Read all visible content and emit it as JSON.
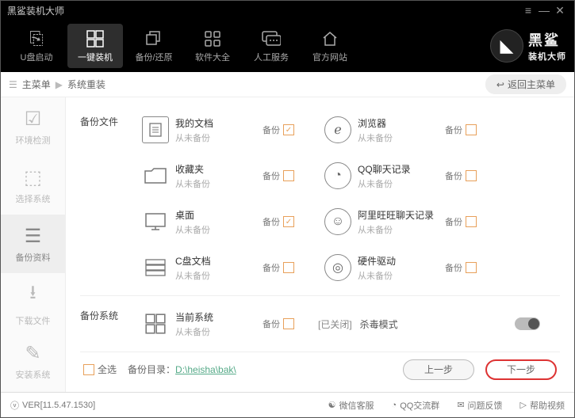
{
  "window_title": "黑鲨装机大师",
  "brand": {
    "t1": "黑鲨",
    "t2": "装机大师"
  },
  "topnav": [
    {
      "label": "U盘启动"
    },
    {
      "label": "一键装机"
    },
    {
      "label": "备份/还原"
    },
    {
      "label": "软件大全"
    },
    {
      "label": "人工服务"
    },
    {
      "label": "官方网站"
    }
  ],
  "crumb": {
    "root": "主菜单",
    "current": "系统重装",
    "back": "返回主菜单"
  },
  "sidebar": [
    {
      "label": "环境检测"
    },
    {
      "label": "选择系统"
    },
    {
      "label": "备份资料"
    },
    {
      "label": "下载文件"
    },
    {
      "label": "安装系统"
    }
  ],
  "sec1_label": "备份文件",
  "sec2_label": "备份系统",
  "status_never": "从未备份",
  "chk_label": "备份",
  "items_left": [
    {
      "t1": "我的文档"
    },
    {
      "t1": "收藏夹"
    },
    {
      "t1": "桌面"
    },
    {
      "t1": "C盘文档"
    }
  ],
  "items_right": [
    {
      "t1": "浏览器"
    },
    {
      "t1": "QQ聊天记录"
    },
    {
      "t1": "阿里旺旺聊天记录"
    },
    {
      "t1": "硬件驱动"
    }
  ],
  "sys_item": {
    "t1": "当前系统"
  },
  "killmode": {
    "off": "[已关闭]",
    "label": "杀毒模式"
  },
  "footer": {
    "selall": "全选",
    "dir_label": "备份目录：",
    "dir_path": "D:\\heisha\\bak\\",
    "prev": "上一步",
    "next": "下一步"
  },
  "status": {
    "ver": "VER[11.5.47.1530]",
    "links": [
      "微信客服",
      "QQ交流群",
      "问题反馈",
      "帮助视频"
    ]
  }
}
